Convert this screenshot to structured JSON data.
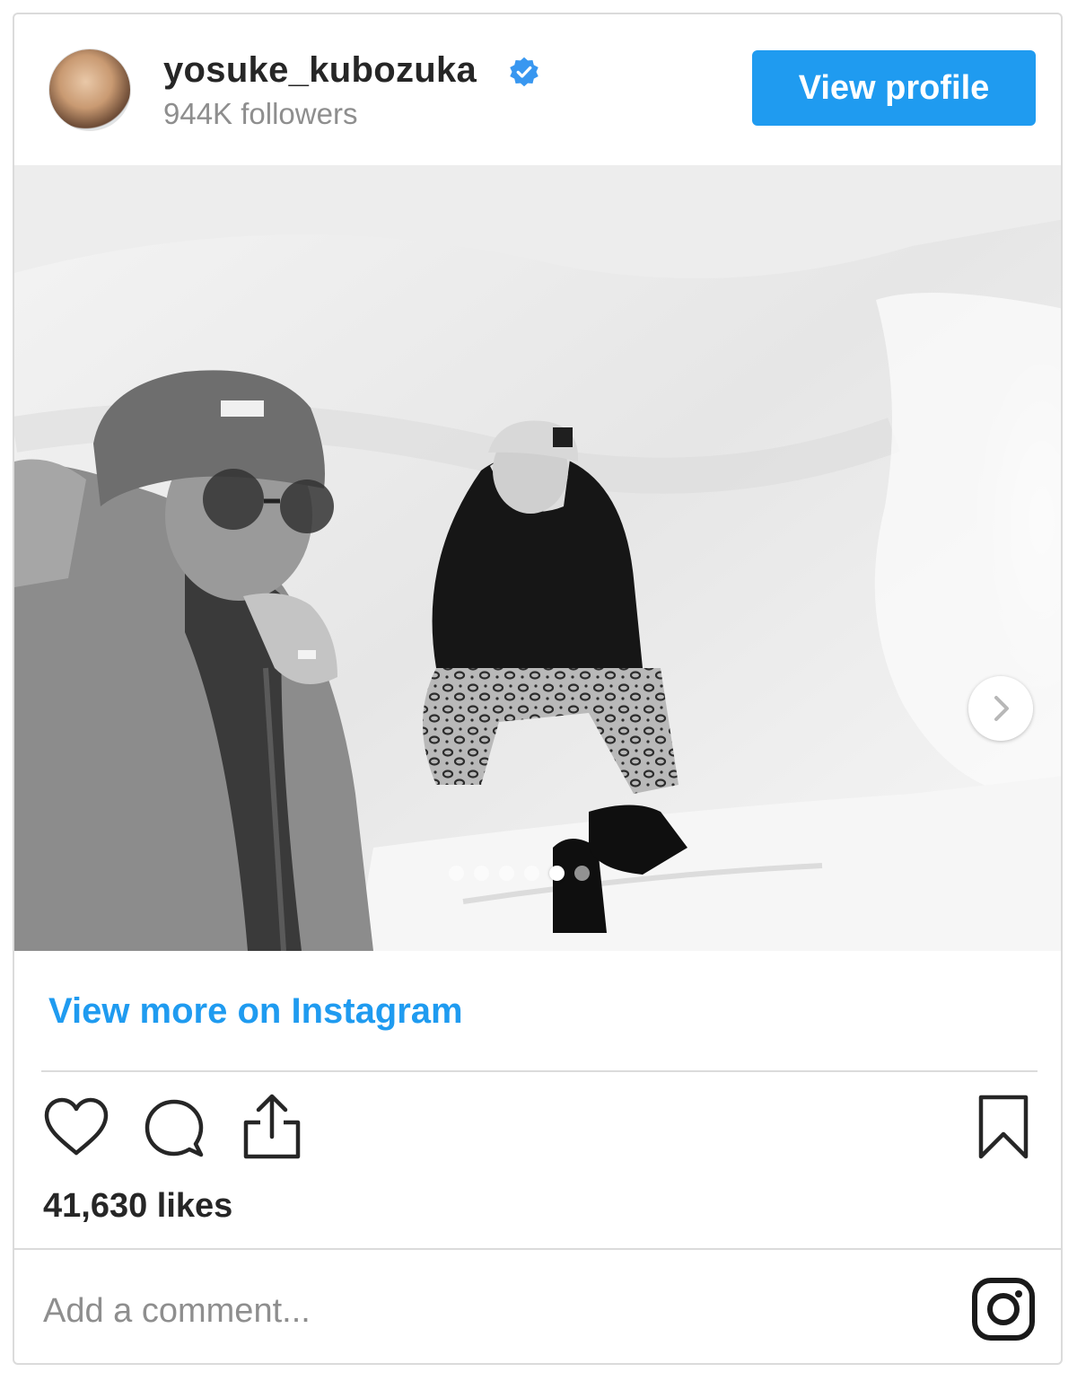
{
  "post": {
    "username": "yosuke_kubozuka",
    "followers": "944K followers",
    "view_profile_label": "View profile",
    "view_more_label": "View more on Instagram",
    "likes": "41,630 likes",
    "comment_placeholder": "Add a comment...",
    "carousel": {
      "total": 6,
      "active_index": 4
    }
  },
  "icons": {
    "verified": "verified-badge-icon",
    "like": "heart-icon",
    "comment": "comment-icon",
    "share": "share-icon",
    "save": "bookmark-icon",
    "next": "chevron-right-icon",
    "brand": "instagram-icon"
  },
  "colors": {
    "accent": "#1f9bf0",
    "text": "#262626",
    "muted": "#8e8e8e",
    "border": "#dbdbdb"
  }
}
